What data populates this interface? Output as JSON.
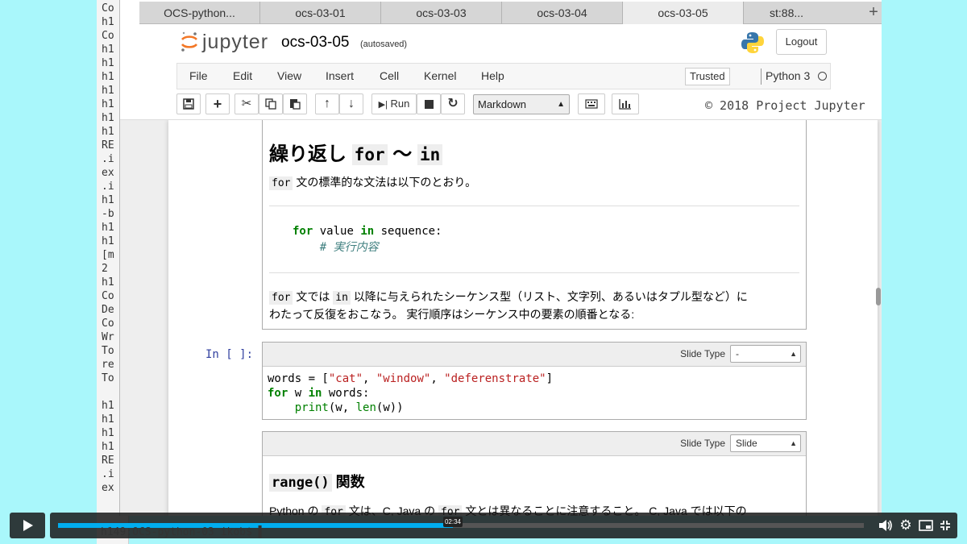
{
  "terminal": {
    "lines": [
      "Co",
      "h1",
      "Co",
      "h1",
      "h1",
      "h1",
      "h1",
      "h1",
      "h1",
      "h1",
      "RE",
      ".i",
      "ex",
      ".i",
      "h1",
      "-b",
      "h1",
      "h1",
      "[m",
      "2",
      "h1",
      "Co",
      "De",
      "Co",
      "Wr",
      "To",
      "re",
      "To",
      "",
      "h1",
      "h1",
      "h1",
      "h1",
      "RE",
      ".i",
      "ex"
    ],
    "bottom_line": "h149:OCS-python-03 ikob$ ▌"
  },
  "browser": {
    "tabs": [
      "OCS-python...",
      "ocs-03-01",
      "ocs-03-03",
      "ocs-03-04",
      "ocs-03-05"
    ],
    "active_tab": 4,
    "extra_tab_text": "st:88...",
    "new_tab_label": "+"
  },
  "jupyter": {
    "brand": "jupyter",
    "notebook_name": "ocs-03-05",
    "autosave": "(autosaved)",
    "logout": "Logout",
    "menu": [
      "File",
      "Edit",
      "View",
      "Insert",
      "Cell",
      "Kernel",
      "Help"
    ],
    "trusted": "Trusted",
    "kernel": "Python 3",
    "toolbar": {
      "run_label": "Run",
      "cell_type": "Markdown",
      "copyright": "© 2018 Project Jupyter"
    }
  },
  "cells": {
    "md1": {
      "heading_prefix": "繰り返し",
      "heading_kw1": "for",
      "heading_tilde": "～",
      "heading_kw2": "in",
      "p1_code": "for",
      "p1_text": "文の標準的な文法は以下のとおり。",
      "code_for": "for",
      "code_value": "value",
      "code_in": "in",
      "code_seq": "sequence:",
      "code_comment": "# 実行内容",
      "p2_code1": "for",
      "p2_text1": "文では",
      "p2_code2": "in",
      "p2_text2": "以降に与えられたシーケンス型（リスト、文字列、あるいはタプル型など）に",
      "p2_text3": "わたって反復をおこなう。 実行順序はシーケンス中の要素の順番となる:"
    },
    "code1": {
      "prompt": "In [ ]:",
      "slide_label": "Slide Type",
      "slide_value": "-",
      "l1_a": "words = [",
      "l1_s1": "\"cat\"",
      "l1_c1": ", ",
      "l1_s2": "\"window\"",
      "l1_c2": ", ",
      "l1_s3": "\"deferenstrate\"",
      "l1_end": "]",
      "l2_for": "for",
      "l2_w": " w ",
      "l2_in": "in",
      "l2_rest": " words:",
      "l3_print": "print",
      "l3_a": "(w, ",
      "l3_len": "len",
      "l3_b": "(w))"
    },
    "md2": {
      "slide_label": "Slide Type",
      "slide_value": "Slide",
      "heading_code": "range()",
      "heading_text": "関数",
      "p_a": "Python の",
      "p_code1": "for",
      "p_b": "文は、C, Java の",
      "p_code2": "for",
      "p_c": "文とは異なることに注意すること。 C, Java では以下の"
    }
  },
  "video": {
    "progress": 0.49,
    "current_time": "02:34"
  },
  "colors": {
    "background": "#a9f7fb",
    "progress": "#00adef",
    "keyword": "#008000",
    "string": "#ba2121",
    "prompt": "#303f9f"
  }
}
